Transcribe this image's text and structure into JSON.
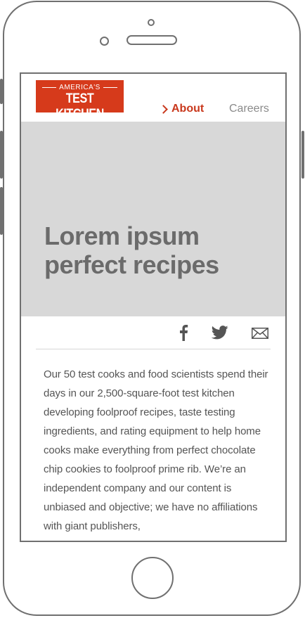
{
  "logo": {
    "top": "AMERICA'S",
    "main": "TEST KITCHEN"
  },
  "nav": {
    "about": "About",
    "careers": "Careers"
  },
  "hero": {
    "title_line1": "Lorem ipsum",
    "title_line2": "perfect recipes"
  },
  "share": {
    "icons": [
      "facebook-icon",
      "twitter-icon",
      "email-icon"
    ]
  },
  "body": {
    "paragraph": "Our 50 test cooks and food scientists spend their days in our 2,500-square-foot test kitchen developing foolproof recipes, taste testing ingredients, and rating equipment to help home cooks make everything from perfect chocolate chip cookies to foolproof prime rib. We’re an independent company and our content is unbiased and objective; we have no affiliations with giant publishers,"
  },
  "colors": {
    "brand": "#d63a1b",
    "hero_bg": "#d8d8d8",
    "text": "#555555",
    "nav_muted": "#8a8a8a"
  }
}
